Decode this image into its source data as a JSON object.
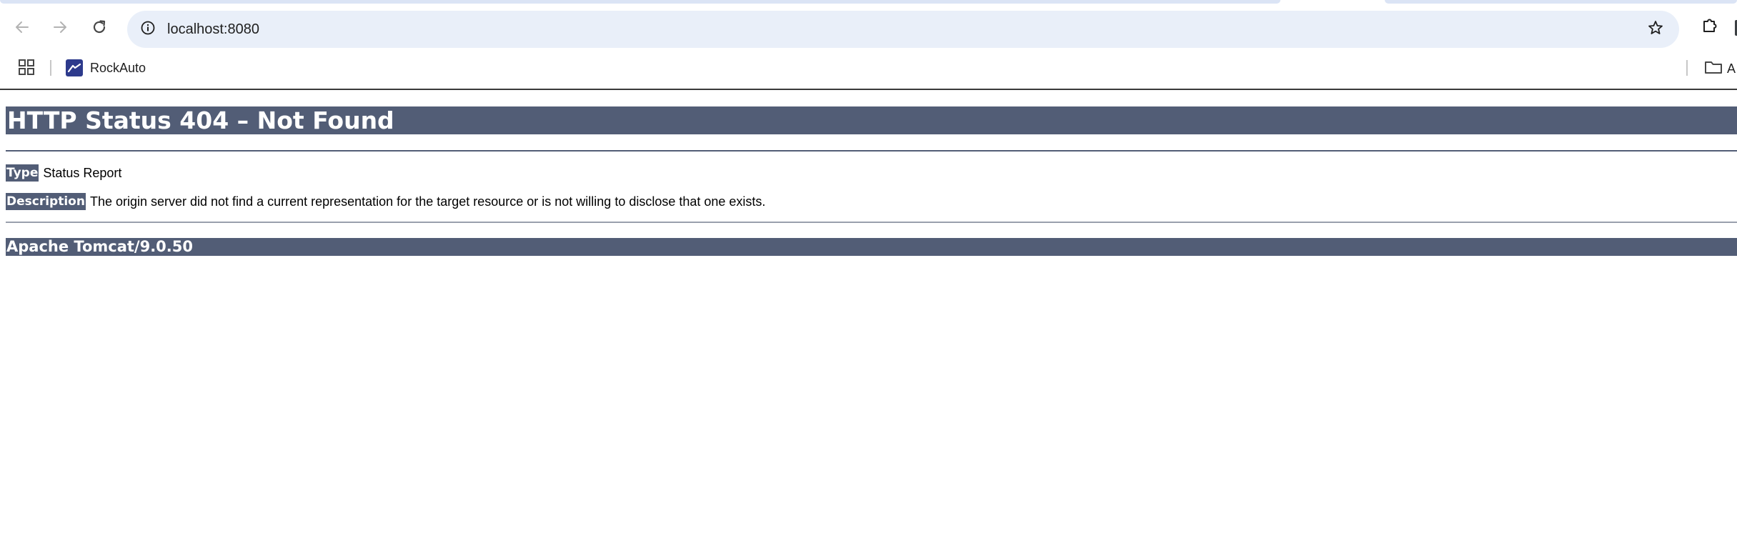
{
  "browser": {
    "url": "localhost:8080",
    "icons": {
      "back": "arrow-left-icon",
      "forward": "arrow-right-icon",
      "reload": "reload-icon",
      "site_info": "info-circle-icon",
      "bookmark_star": "star-outline-icon",
      "extensions": "puzzle-icon",
      "apps": "apps-grid-icon",
      "folder": "folder-icon"
    },
    "bookmarks_bar": {
      "items": [
        {
          "label": "RockAuto",
          "icon": "rockauto-favicon"
        }
      ],
      "folder_label": "A"
    }
  },
  "page": {
    "title": "HTTP Status 404 – Not Found",
    "type_label": "Type",
    "type_value": "Status Report",
    "description_label": "Description",
    "description_value": "The origin server did not find a current representation for the target resource or is not willing to disclose that one exists.",
    "server_footer": "Apache Tomcat/9.0.50"
  },
  "colors": {
    "tomcat_header_bg": "#525d76",
    "tomcat_header_text": "#ffffff",
    "omnibox_bg": "#e9eff9",
    "tab_sliver": "#dbe4f5"
  }
}
